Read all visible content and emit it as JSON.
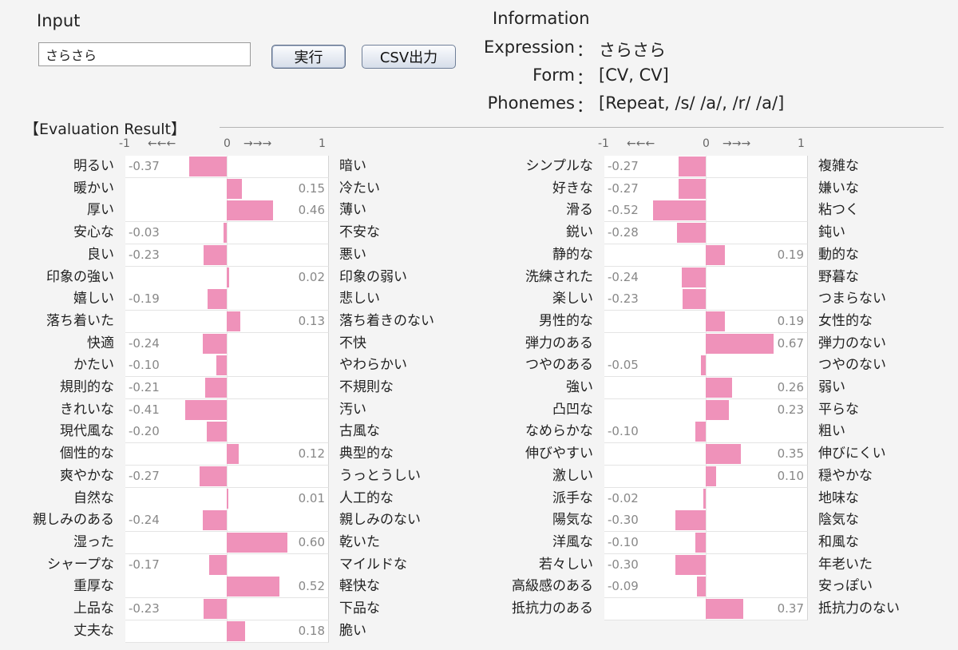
{
  "input": {
    "title": "Input",
    "value": "さらさら",
    "run_label": "実行",
    "csv_label": "CSV出力"
  },
  "information": {
    "title": "Information",
    "colon": "：",
    "expression_label": "Expression",
    "expression_value": "さらさら",
    "form_label": "Form",
    "form_value": "[CV, CV]",
    "phonemes_label": "Phonemes",
    "phonemes_value": "[Repeat, /s/ /a/, /r/ /a/]"
  },
  "result": {
    "title": "【Evaluation Result】",
    "scale": {
      "min": "-1",
      "left_arrows": "←←←",
      "zero": "0",
      "right_arrows": "→→→",
      "max": "1"
    },
    "left_panel": [
      {
        "left": "明るい",
        "right": "暗い",
        "value": -0.37,
        "text": "-0.37"
      },
      {
        "left": "暖かい",
        "right": "冷たい",
        "value": 0.15,
        "text": "0.15"
      },
      {
        "left": "厚い",
        "right": "薄い",
        "value": 0.46,
        "text": "0.46"
      },
      {
        "left": "安心な",
        "right": "不安な",
        "value": -0.03,
        "text": "-0.03"
      },
      {
        "left": "良い",
        "right": "悪い",
        "value": -0.23,
        "text": "-0.23"
      },
      {
        "left": "印象の強い",
        "right": "印象の弱い",
        "value": 0.02,
        "text": "0.02"
      },
      {
        "left": "嬉しい",
        "right": "悲しい",
        "value": -0.19,
        "text": "-0.19"
      },
      {
        "left": "落ち着いた",
        "right": "落ち着きのない",
        "value": 0.13,
        "text": "0.13"
      },
      {
        "left": "快適",
        "right": "不快",
        "value": -0.24,
        "text": "-0.24"
      },
      {
        "left": "かたい",
        "right": "やわらかい",
        "value": -0.1,
        "text": "-0.10"
      },
      {
        "left": "規則的な",
        "right": "不規則な",
        "value": -0.21,
        "text": "-0.21"
      },
      {
        "left": "きれいな",
        "right": "汚い",
        "value": -0.41,
        "text": "-0.41"
      },
      {
        "left": "現代風な",
        "right": "古風な",
        "value": -0.2,
        "text": "-0.20"
      },
      {
        "left": "個性的な",
        "right": "典型的な",
        "value": 0.12,
        "text": "0.12"
      },
      {
        "left": "爽やかな",
        "right": "うっとうしい",
        "value": -0.27,
        "text": "-0.27"
      },
      {
        "left": "自然な",
        "right": "人工的な",
        "value": 0.01,
        "text": "0.01"
      },
      {
        "left": "親しみのある",
        "right": "親しみのない",
        "value": -0.24,
        "text": "-0.24"
      },
      {
        "left": "湿った",
        "right": "乾いた",
        "value": 0.6,
        "text": "0.60"
      },
      {
        "left": "シャープな",
        "right": "マイルドな",
        "value": -0.17,
        "text": "-0.17"
      },
      {
        "left": "重厚な",
        "right": "軽快な",
        "value": 0.52,
        "text": "0.52"
      },
      {
        "left": "上品な",
        "right": "下品な",
        "value": -0.23,
        "text": "-0.23"
      },
      {
        "left": "丈夫な",
        "right": "脆い",
        "value": 0.18,
        "text": "0.18"
      }
    ],
    "right_panel": [
      {
        "left": "シンプルな",
        "right": "複雑な",
        "value": -0.27,
        "text": "-0.27"
      },
      {
        "left": "好きな",
        "right": "嫌いな",
        "value": -0.27,
        "text": "-0.27"
      },
      {
        "left": "滑る",
        "right": "粘つく",
        "value": -0.52,
        "text": "-0.52"
      },
      {
        "left": "鋭い",
        "right": "鈍い",
        "value": -0.28,
        "text": "-0.28"
      },
      {
        "left": "静的な",
        "right": "動的な",
        "value": 0.19,
        "text": "0.19"
      },
      {
        "left": "洗練された",
        "right": "野暮な",
        "value": -0.24,
        "text": "-0.24"
      },
      {
        "left": "楽しい",
        "right": "つまらない",
        "value": -0.23,
        "text": "-0.23"
      },
      {
        "left": "男性的な",
        "right": "女性的な",
        "value": 0.19,
        "text": "0.19"
      },
      {
        "left": "弾力のある",
        "right": "弾力のない",
        "value": 0.67,
        "text": "0.67"
      },
      {
        "left": "つやのある",
        "right": "つやのない",
        "value": -0.05,
        "text": "-0.05"
      },
      {
        "left": "強い",
        "right": "弱い",
        "value": 0.26,
        "text": "0.26"
      },
      {
        "left": "凸凹な",
        "right": "平らな",
        "value": 0.23,
        "text": "0.23"
      },
      {
        "left": "なめらかな",
        "right": "粗い",
        "value": -0.1,
        "text": "-0.10"
      },
      {
        "left": "伸びやすい",
        "right": "伸びにくい",
        "value": 0.35,
        "text": "0.35"
      },
      {
        "left": "激しい",
        "right": "穏やかな",
        "value": 0.1,
        "text": "0.10"
      },
      {
        "left": "派手な",
        "right": "地味な",
        "value": -0.02,
        "text": "-0.02"
      },
      {
        "left": "陽気な",
        "right": "陰気な",
        "value": -0.3,
        "text": "-0.30"
      },
      {
        "left": "洋風な",
        "right": "和風な",
        "value": -0.1,
        "text": "-0.10"
      },
      {
        "left": "若々しい",
        "right": "年老いた",
        "value": -0.3,
        "text": "-0.30"
      },
      {
        "left": "高級感のある",
        "right": "安っぽい",
        "value": -0.09,
        "text": "-0.09"
      },
      {
        "left": "抵抗力のある",
        "right": "抵抗力のない",
        "value": 0.37,
        "text": "0.37"
      }
    ]
  },
  "colors": {
    "bar": "#ef92ba",
    "value_text": "#888888"
  }
}
